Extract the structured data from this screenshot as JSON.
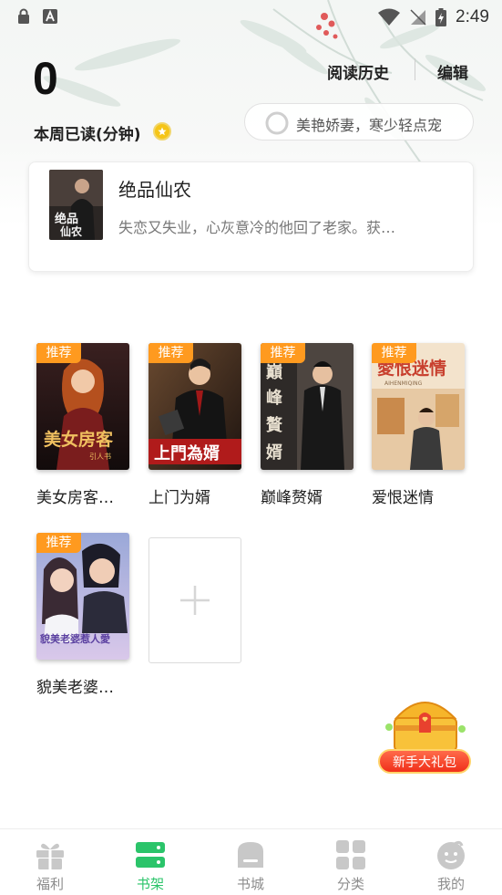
{
  "status_bar": {
    "time": "2:49"
  },
  "header": {
    "read_minutes": "0",
    "read_label": "本周已读(分钟)",
    "history_label": "阅读历史",
    "edit_label": "编辑",
    "search_placeholder": "美艳娇妻，寒少轻点宠"
  },
  "recent": {
    "title": "绝品仙农",
    "description": "失恋又失业，心灰意冷的他回了老家。获…"
  },
  "shelf": {
    "badge_label": "推荐",
    "books": [
      {
        "title": "美女房客…",
        "badge": "推荐",
        "cover_text": "美女房客"
      },
      {
        "title": "上门为婿",
        "badge": "推荐",
        "cover_text": "上門為婿"
      },
      {
        "title": "巅峰赘婿",
        "badge": "推荐",
        "cover_text": "巔峰贅婿"
      },
      {
        "title": "爱恨迷情",
        "badge": "推荐",
        "cover_text": "愛恨迷情"
      },
      {
        "title": "貌美老婆…",
        "badge": "推荐",
        "cover_text": "貌美老婆惹人愛"
      }
    ]
  },
  "gift": {
    "label": "新手大礼包"
  },
  "bottom_nav": {
    "active": "书架",
    "items": [
      {
        "label": "福利",
        "icon": "gift-icon"
      },
      {
        "label": "书架",
        "icon": "bookshelf-icon"
      },
      {
        "label": "书城",
        "icon": "bookstore-icon"
      },
      {
        "label": "分类",
        "icon": "grid-icon"
      },
      {
        "label": "我的",
        "icon": "profile-icon"
      }
    ]
  },
  "colors": {
    "accent": "#2bc46a",
    "badge": "#ff9a1f",
    "coin": "#f5c518"
  }
}
